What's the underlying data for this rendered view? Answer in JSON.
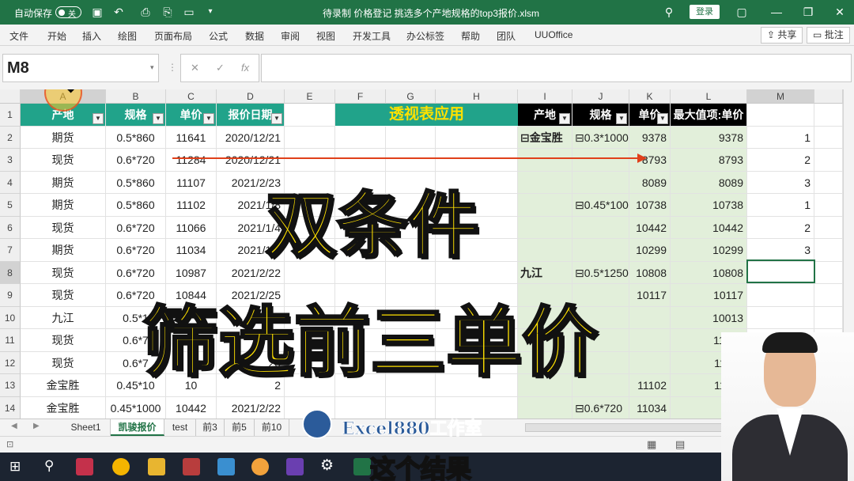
{
  "titlebar": {
    "autosave_label": "自动保存",
    "autosave_state": "关",
    "title": "待录制  价格登记 挑选多个产地规格的top3报价.xlsm",
    "signin": "登录",
    "icons": [
      "save-icon",
      "undo-icon",
      "redo-icon",
      "print-icon",
      "pdf-icon",
      "new-file-icon",
      "more-icon",
      "search-icon",
      "restore-icon",
      "minimize-icon",
      "maximize-icon",
      "close-icon"
    ]
  },
  "menu": [
    "文件",
    "开始",
    "插入",
    "绘图",
    "页面布局",
    "公式",
    "数据",
    "审阅",
    "视图",
    "开发工具",
    "办公标签",
    "帮助",
    "团队",
    "UUOffice"
  ],
  "share_label": "共享",
  "comment_label": "批注",
  "namebox": "M8",
  "fx_label": "fx",
  "columns": [
    "A",
    "B",
    "C",
    "D",
    "E",
    "F",
    "G",
    "H",
    "I",
    "J",
    "K",
    "L",
    "M"
  ],
  "rows": [
    "1",
    "2",
    "3",
    "4",
    "5",
    "6",
    "7",
    "8",
    "9",
    "10",
    "11",
    "12",
    "13",
    "14"
  ],
  "table_headers": [
    "产地",
    "规格",
    "单价",
    "报价日期"
  ],
  "table_rows": [
    [
      "期货",
      "0.5*860",
      "11641",
      "2020/12/21"
    ],
    [
      "现货",
      "0.6*720",
      "11284",
      "2020/12/21"
    ],
    [
      "期货",
      "0.5*860",
      "11107",
      "2021/2/23"
    ],
    [
      "期货",
      "0.5*860",
      "11102",
      "2021/1/8"
    ],
    [
      "现货",
      "0.6*720",
      "11066",
      "2021/1/4"
    ],
    [
      "期货",
      "0.6*720",
      "11034",
      "2021/1/8"
    ],
    [
      "现货",
      "0.6*720",
      "10987",
      "2021/2/22"
    ],
    [
      "现货",
      "0.6*720",
      "10844",
      "2021/2/25"
    ],
    [
      "九江",
      "0.5*1",
      "",
      ""
    ],
    [
      "现货",
      "0.6*7",
      "",
      ""
    ],
    [
      "现货",
      "0.6*7",
      "",
      "20"
    ],
    [
      "金宝胜",
      "0.45*10",
      "10",
      "2"
    ],
    [
      "金宝胜",
      "0.45*1000",
      "10442",
      "2021/2/22"
    ]
  ],
  "pivot_banner": "透视表应用",
  "pivot_headers": [
    "产地",
    "规格",
    "单价",
    "最大值项:单价"
  ],
  "pivot_rows": [
    [
      "⊟金宝胜",
      "⊟0.3*1000",
      "9378",
      "9378",
      "1"
    ],
    [
      "",
      "",
      "8793",
      "8793",
      "2"
    ],
    [
      "",
      "",
      "8089",
      "8089",
      "3"
    ],
    [
      "",
      "⊟0.45*100",
      "10738",
      "10738",
      "1"
    ],
    [
      "",
      "",
      "10442",
      "10442",
      "2"
    ],
    [
      "",
      "",
      "10299",
      "10299",
      "3"
    ],
    [
      "九江",
      "⊟0.5*1250",
      "10808",
      "10808",
      ""
    ],
    [
      "",
      "",
      "10117",
      "10117",
      ""
    ],
    [
      "",
      "",
      "",
      "10013",
      ""
    ],
    [
      "",
      "",
      "",
      "11641",
      ""
    ],
    [
      "",
      "",
      "",
      "11107",
      ""
    ],
    [
      "",
      "",
      "11102",
      "11102",
      ""
    ],
    [
      "",
      "⊟0.6*720",
      "11034",
      "110",
      ""
    ]
  ],
  "sheet_tabs": [
    "Sheet1",
    "凯骏报价",
    "test",
    "前3",
    "前5",
    "前10"
  ],
  "overlay": {
    "line1": "双条件",
    "line2": "筛选前三单价",
    "watermark": "Excel880工作室",
    "subtitle": "这个结果"
  },
  "colors": {
    "excel_green": "#217346",
    "header_teal": "#21a38a",
    "caption_yellow": "#ffe100",
    "pivot_green": "#e2efda"
  }
}
